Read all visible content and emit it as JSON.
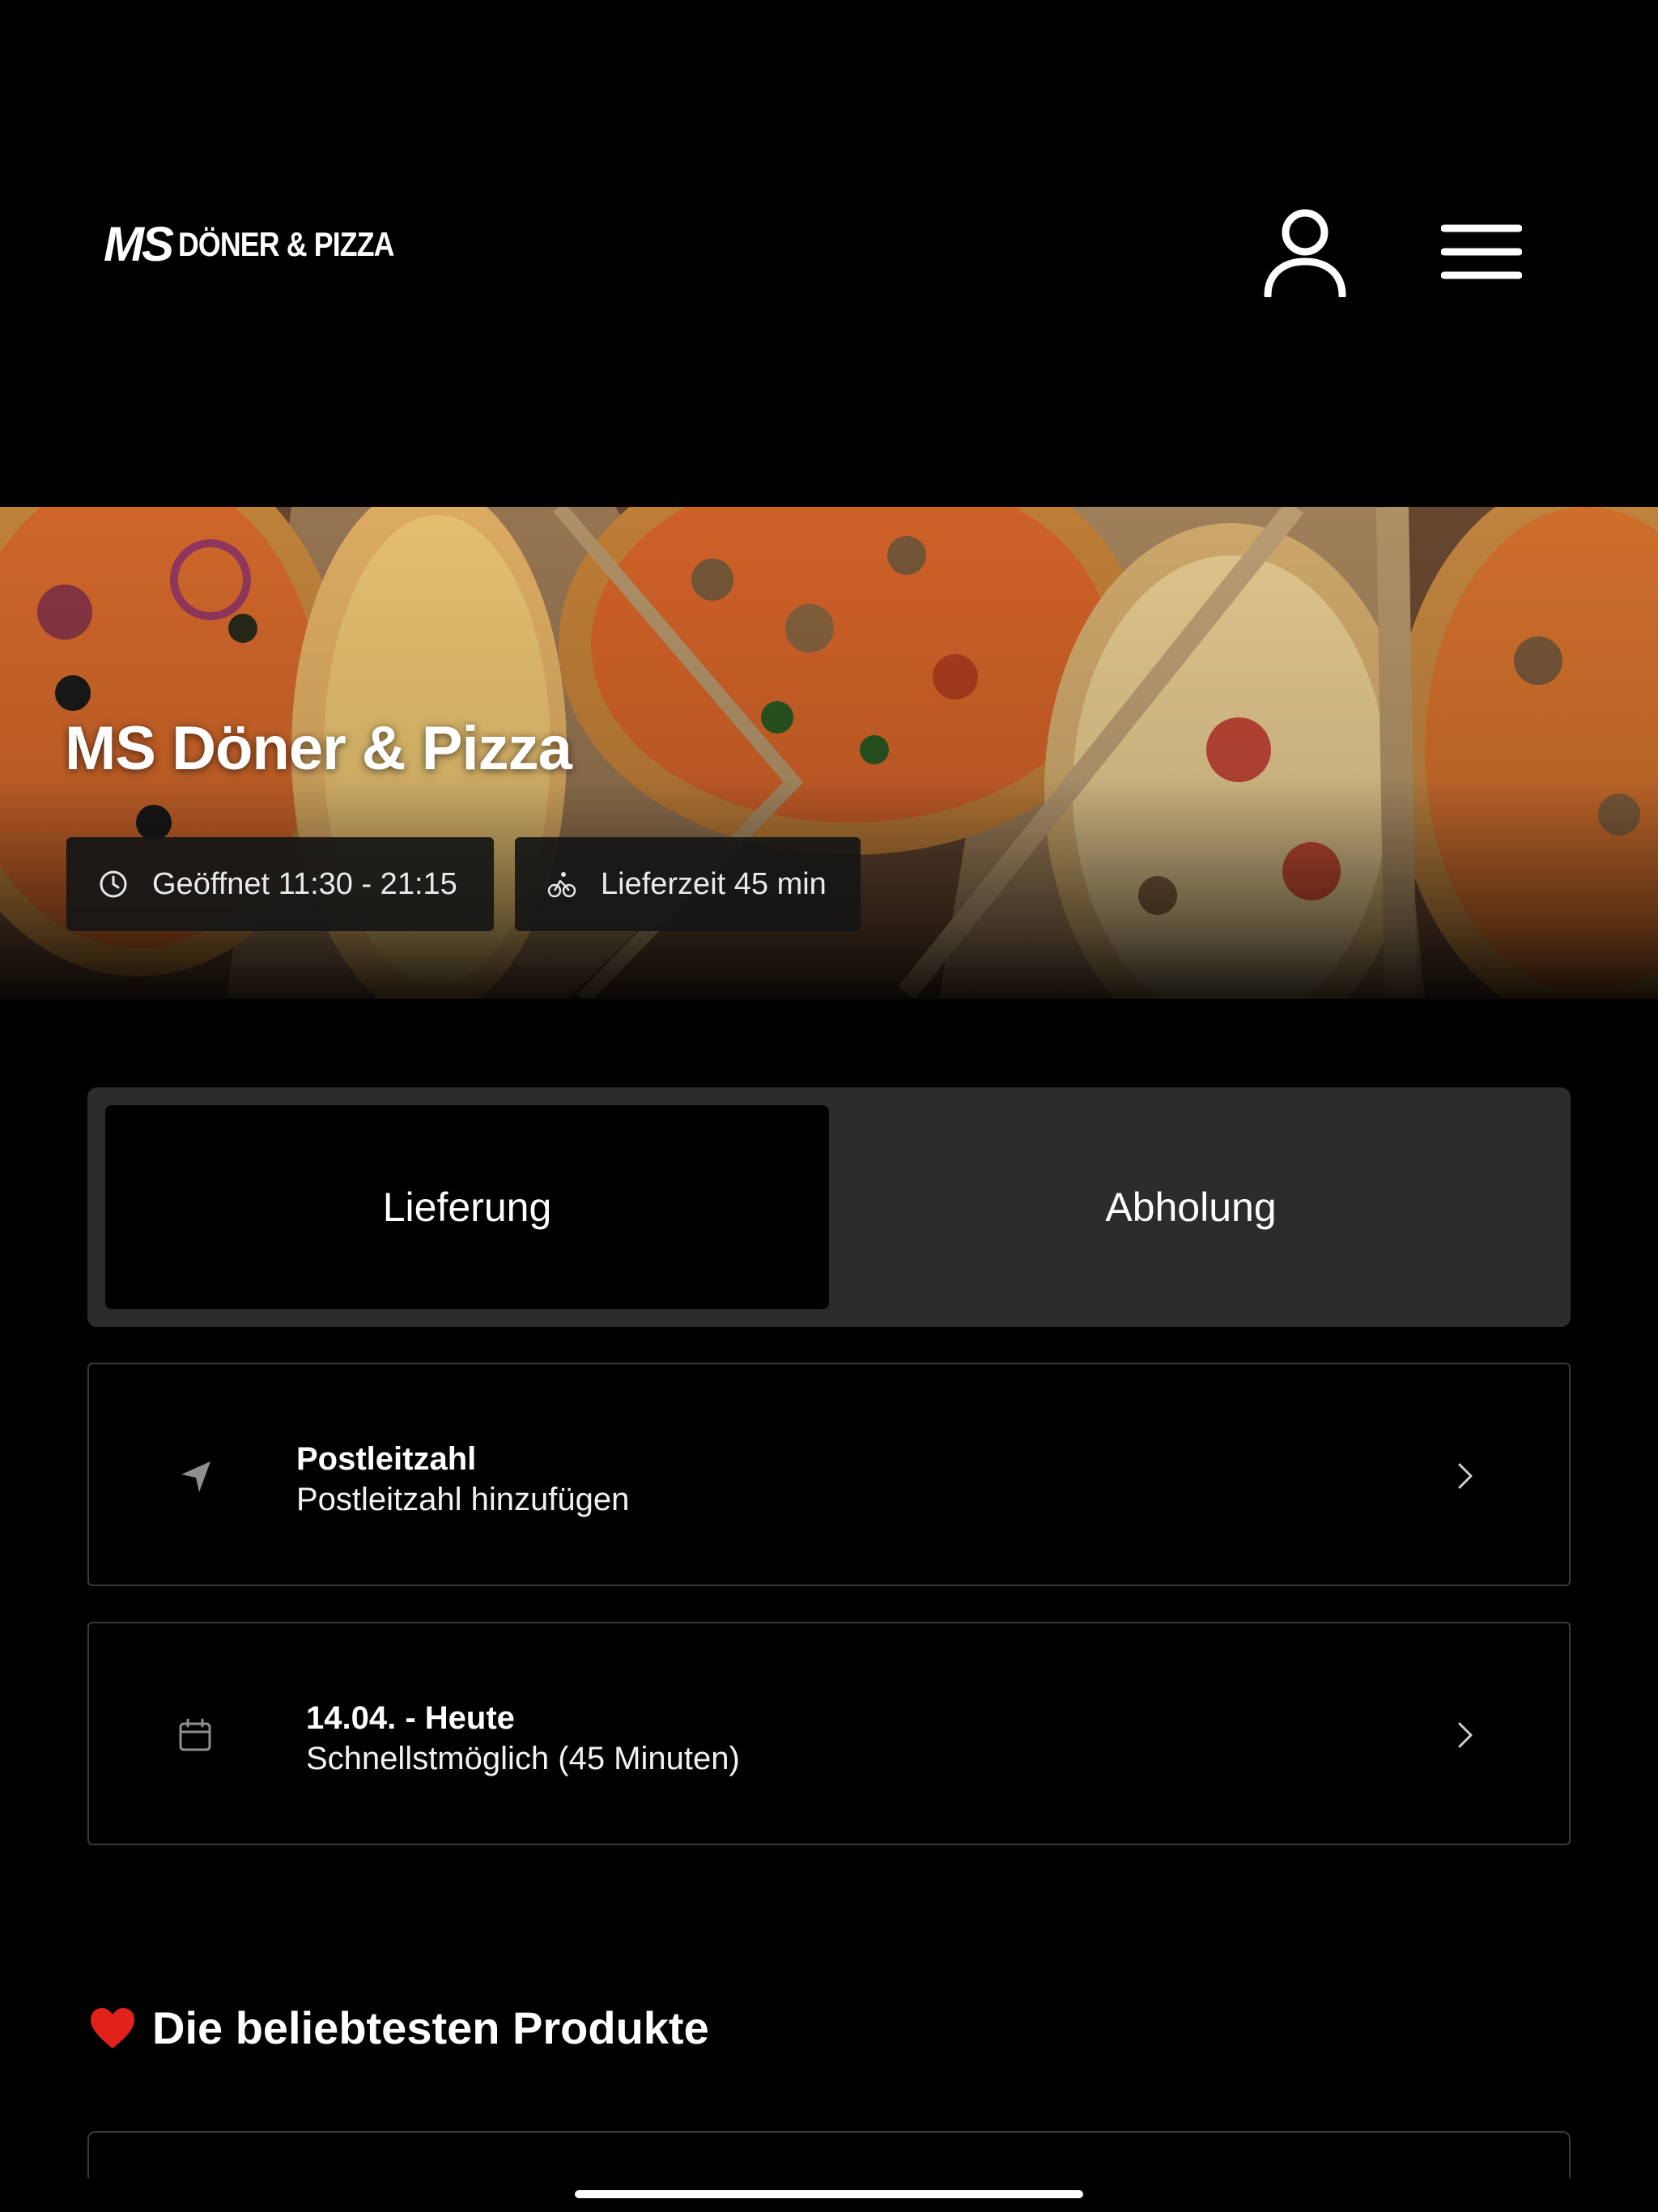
{
  "header": {
    "logo_mark": "MS",
    "logo_text": "DÖNER & PIZZA",
    "user_icon": "user-icon",
    "menu_icon": "hamburger-menu-icon"
  },
  "hero": {
    "title": "MS Döner & Pizza",
    "opening_hours": "Geöffnet 11:30 - 21:15",
    "delivery_time": "Lieferzeit 45 min",
    "clock_icon": "clock-icon",
    "bike_icon": "bicycle-icon"
  },
  "order_mode": {
    "options": [
      "Lieferung",
      "Abholung"
    ],
    "selected": "Lieferung"
  },
  "postal": {
    "icon": "location-arrow-icon",
    "title": "Postleitzahl",
    "subtitle": "Postleitzahl hinzufügen"
  },
  "schedule": {
    "icon": "calendar-icon",
    "title": "14.04. - Heute",
    "subtitle": "Schnellstmöglich (45 Minuten)"
  },
  "popular": {
    "heading": "Die beliebtesten Produkte",
    "emoji_icon": "heart-icon"
  },
  "colors": {
    "background": "#000000",
    "segment_bg": "#2c2c2e",
    "border": "#3a3a3c",
    "heart": "#e0221b"
  }
}
